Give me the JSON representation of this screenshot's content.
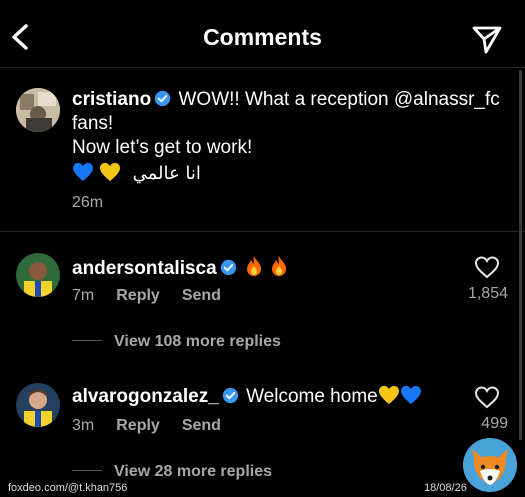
{
  "header": {
    "title": "Comments",
    "back_icon": "chevron-left-icon",
    "share_icon": "paper-plane-icon"
  },
  "caption": {
    "username": "cristiano",
    "text_line1": "WOW!! What a reception @alnassr_fc",
    "text_line2": "fans!",
    "text_line3": "Now let’s get to work!",
    "hearts": [
      "blue-heart",
      "yellow-heart"
    ],
    "arabic_text": "انا عالمي",
    "time": "26m"
  },
  "comments": [
    {
      "username": "andersontalisca",
      "emoji": [
        "fire",
        "fire"
      ],
      "time": "7m",
      "reply_label": "Reply",
      "send_label": "Send",
      "likes": "1,854",
      "view_replies": "View 108 more replies"
    },
    {
      "username": "alvarogonzalez_",
      "text": "Welcome home",
      "emoji": [
        "yellow-heart",
        "blue-heart"
      ],
      "time": "3m",
      "reply_label": "Reply",
      "send_label": "Send",
      "likes": "499",
      "view_replies": "View 28 more replies"
    }
  ],
  "watermark": {
    "left": "foxdeo.com/@t.khan756",
    "right": "18/08/26"
  },
  "colors": {
    "background": "#000000",
    "verified": "#3897f0",
    "muted": "#a8a8a8",
    "blue_heart": "#1877f2",
    "yellow_heart": "#f5c518",
    "fire": "#ff6a00"
  }
}
